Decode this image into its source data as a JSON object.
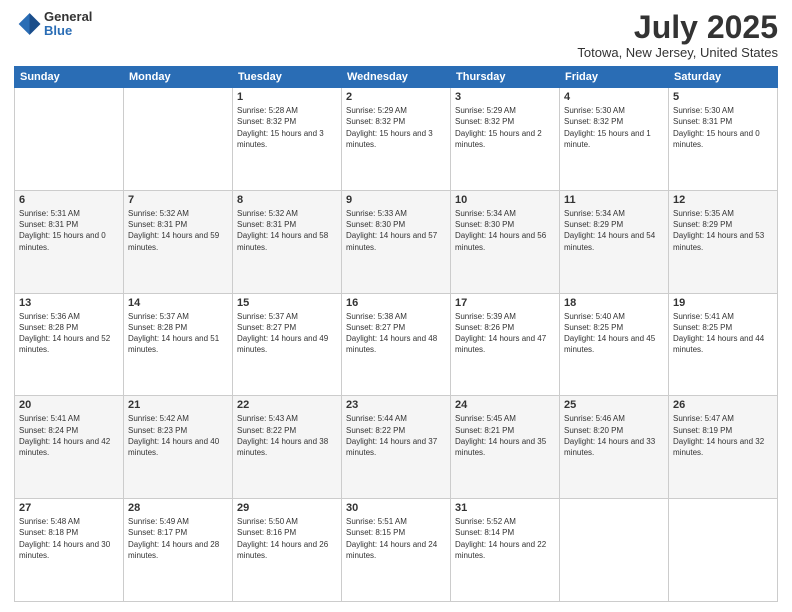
{
  "header": {
    "logo": {
      "general": "General",
      "blue": "Blue"
    },
    "title": "July 2025",
    "subtitle": "Totowa, New Jersey, United States"
  },
  "days_of_week": [
    "Sunday",
    "Monday",
    "Tuesday",
    "Wednesday",
    "Thursday",
    "Friday",
    "Saturday"
  ],
  "weeks": [
    [
      {
        "day": "",
        "info": ""
      },
      {
        "day": "",
        "info": ""
      },
      {
        "day": "1",
        "info": "Sunrise: 5:28 AM\nSunset: 8:32 PM\nDaylight: 15 hours and 3 minutes."
      },
      {
        "day": "2",
        "info": "Sunrise: 5:29 AM\nSunset: 8:32 PM\nDaylight: 15 hours and 3 minutes."
      },
      {
        "day": "3",
        "info": "Sunrise: 5:29 AM\nSunset: 8:32 PM\nDaylight: 15 hours and 2 minutes."
      },
      {
        "day": "4",
        "info": "Sunrise: 5:30 AM\nSunset: 8:32 PM\nDaylight: 15 hours and 1 minute."
      },
      {
        "day": "5",
        "info": "Sunrise: 5:30 AM\nSunset: 8:31 PM\nDaylight: 15 hours and 0 minutes."
      }
    ],
    [
      {
        "day": "6",
        "info": "Sunrise: 5:31 AM\nSunset: 8:31 PM\nDaylight: 15 hours and 0 minutes."
      },
      {
        "day": "7",
        "info": "Sunrise: 5:32 AM\nSunset: 8:31 PM\nDaylight: 14 hours and 59 minutes."
      },
      {
        "day": "8",
        "info": "Sunrise: 5:32 AM\nSunset: 8:31 PM\nDaylight: 14 hours and 58 minutes."
      },
      {
        "day": "9",
        "info": "Sunrise: 5:33 AM\nSunset: 8:30 PM\nDaylight: 14 hours and 57 minutes."
      },
      {
        "day": "10",
        "info": "Sunrise: 5:34 AM\nSunset: 8:30 PM\nDaylight: 14 hours and 56 minutes."
      },
      {
        "day": "11",
        "info": "Sunrise: 5:34 AM\nSunset: 8:29 PM\nDaylight: 14 hours and 54 minutes."
      },
      {
        "day": "12",
        "info": "Sunrise: 5:35 AM\nSunset: 8:29 PM\nDaylight: 14 hours and 53 minutes."
      }
    ],
    [
      {
        "day": "13",
        "info": "Sunrise: 5:36 AM\nSunset: 8:28 PM\nDaylight: 14 hours and 52 minutes."
      },
      {
        "day": "14",
        "info": "Sunrise: 5:37 AM\nSunset: 8:28 PM\nDaylight: 14 hours and 51 minutes."
      },
      {
        "day": "15",
        "info": "Sunrise: 5:37 AM\nSunset: 8:27 PM\nDaylight: 14 hours and 49 minutes."
      },
      {
        "day": "16",
        "info": "Sunrise: 5:38 AM\nSunset: 8:27 PM\nDaylight: 14 hours and 48 minutes."
      },
      {
        "day": "17",
        "info": "Sunrise: 5:39 AM\nSunset: 8:26 PM\nDaylight: 14 hours and 47 minutes."
      },
      {
        "day": "18",
        "info": "Sunrise: 5:40 AM\nSunset: 8:25 PM\nDaylight: 14 hours and 45 minutes."
      },
      {
        "day": "19",
        "info": "Sunrise: 5:41 AM\nSunset: 8:25 PM\nDaylight: 14 hours and 44 minutes."
      }
    ],
    [
      {
        "day": "20",
        "info": "Sunrise: 5:41 AM\nSunset: 8:24 PM\nDaylight: 14 hours and 42 minutes."
      },
      {
        "day": "21",
        "info": "Sunrise: 5:42 AM\nSunset: 8:23 PM\nDaylight: 14 hours and 40 minutes."
      },
      {
        "day": "22",
        "info": "Sunrise: 5:43 AM\nSunset: 8:22 PM\nDaylight: 14 hours and 38 minutes."
      },
      {
        "day": "23",
        "info": "Sunrise: 5:44 AM\nSunset: 8:22 PM\nDaylight: 14 hours and 37 minutes."
      },
      {
        "day": "24",
        "info": "Sunrise: 5:45 AM\nSunset: 8:21 PM\nDaylight: 14 hours and 35 minutes."
      },
      {
        "day": "25",
        "info": "Sunrise: 5:46 AM\nSunset: 8:20 PM\nDaylight: 14 hours and 33 minutes."
      },
      {
        "day": "26",
        "info": "Sunrise: 5:47 AM\nSunset: 8:19 PM\nDaylight: 14 hours and 32 minutes."
      }
    ],
    [
      {
        "day": "27",
        "info": "Sunrise: 5:48 AM\nSunset: 8:18 PM\nDaylight: 14 hours and 30 minutes."
      },
      {
        "day": "28",
        "info": "Sunrise: 5:49 AM\nSunset: 8:17 PM\nDaylight: 14 hours and 28 minutes."
      },
      {
        "day": "29",
        "info": "Sunrise: 5:50 AM\nSunset: 8:16 PM\nDaylight: 14 hours and 26 minutes."
      },
      {
        "day": "30",
        "info": "Sunrise: 5:51 AM\nSunset: 8:15 PM\nDaylight: 14 hours and 24 minutes."
      },
      {
        "day": "31",
        "info": "Sunrise: 5:52 AM\nSunset: 8:14 PM\nDaylight: 14 hours and 22 minutes."
      },
      {
        "day": "",
        "info": ""
      },
      {
        "day": "",
        "info": ""
      }
    ]
  ]
}
